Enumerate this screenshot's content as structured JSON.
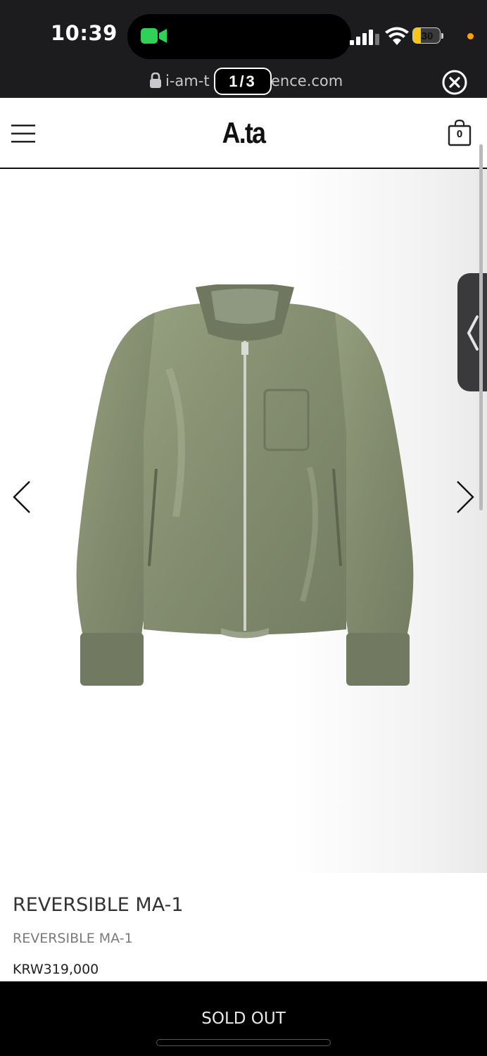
{
  "status_bar": {
    "time": "10:39",
    "battery_level": "30",
    "battery_fraction": 0.3
  },
  "browser": {
    "url_left": "i-am-t",
    "url_right": "ence.com",
    "page_counter": "1/3"
  },
  "site": {
    "logo": "A.ta",
    "cart_count": "0"
  },
  "product": {
    "title": "REVERSIBLE MA-1",
    "subtitle": "REVERSIBLE MA-1",
    "price": "KRW319,000",
    "image_color": "#8a9178",
    "cta_label": "SOLD OUT"
  },
  "icons": {
    "menu": "menu-icon",
    "cart": "shopping-bag-icon",
    "prev": "chevron-left-icon",
    "next": "chevron-right-icon",
    "close": "close-circle-icon",
    "lock": "lock-icon"
  }
}
